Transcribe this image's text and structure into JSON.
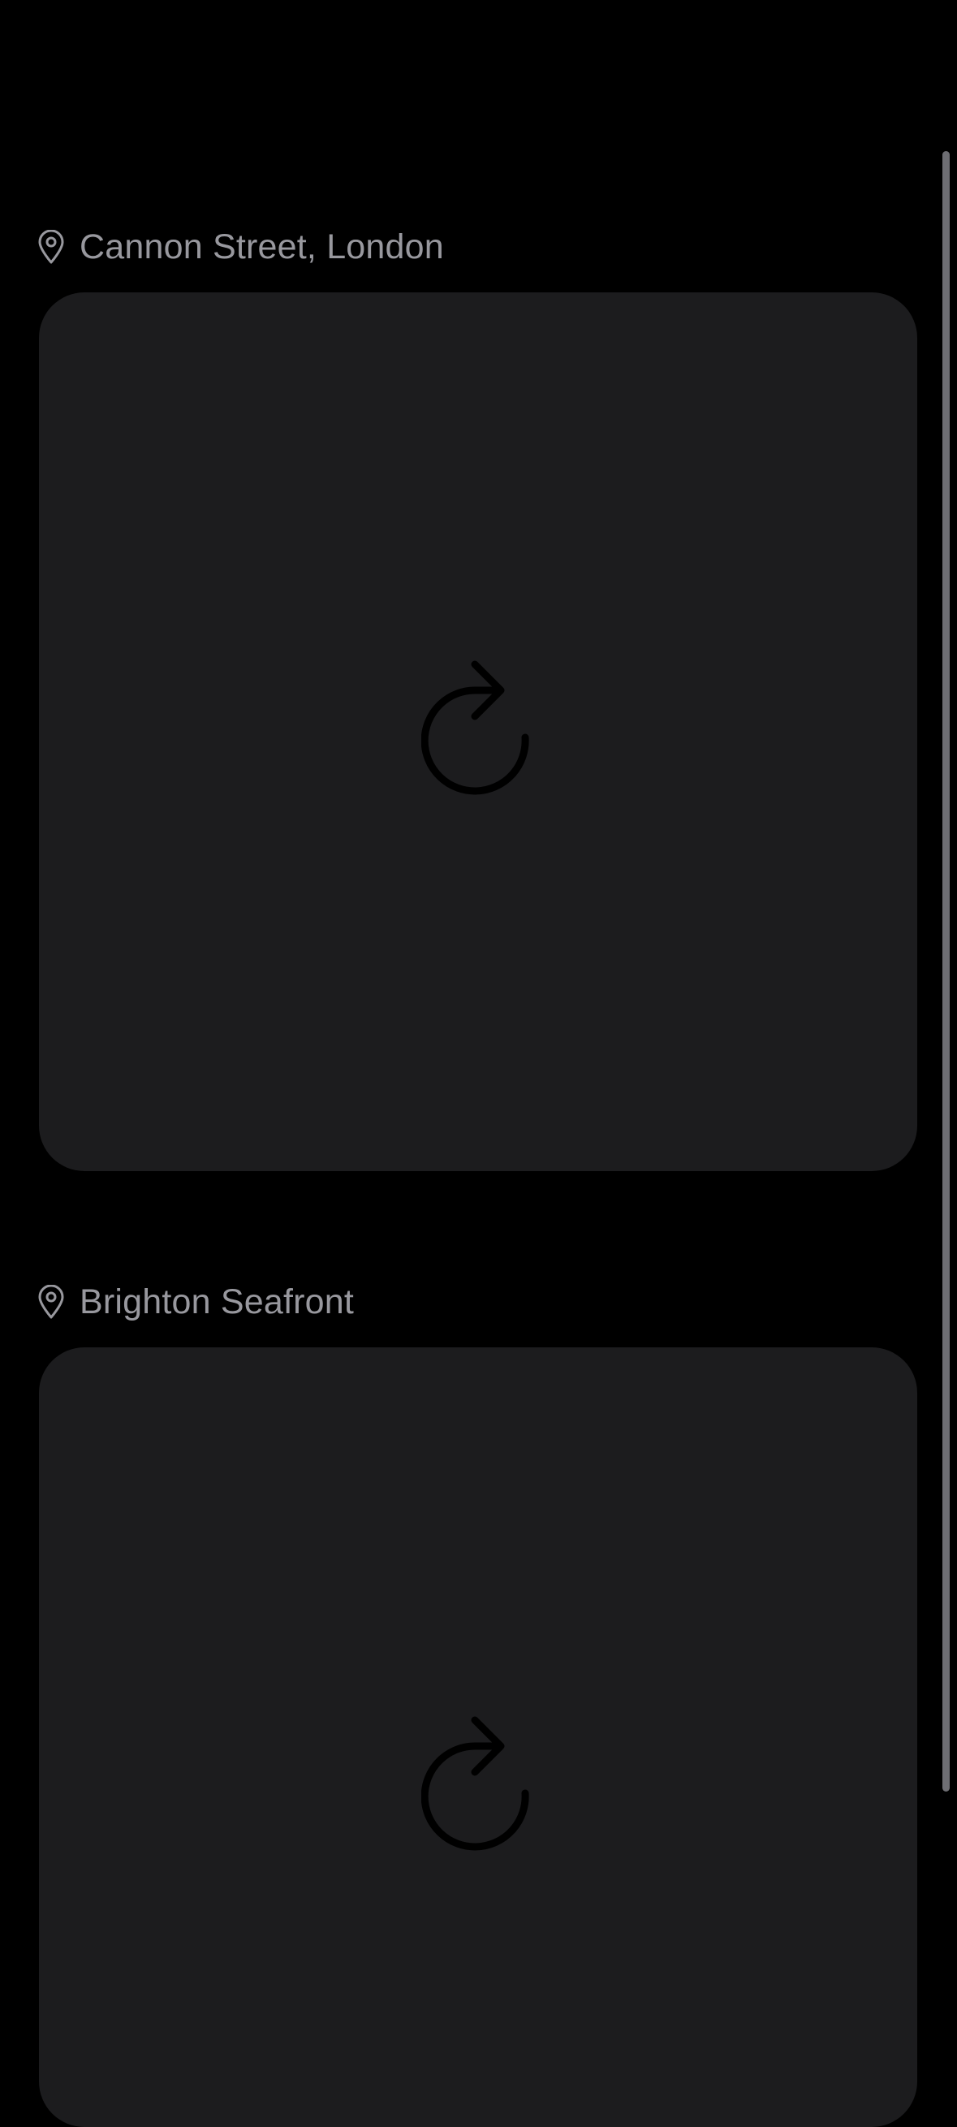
{
  "colors": {
    "background": "#000000",
    "card": "#1c1c1e",
    "label_text": "#98989e",
    "reload_icon": "#000000",
    "scrollbar": "#6e6e73"
  },
  "feed": {
    "items": [
      {
        "location": "Cannon Street, London",
        "pin_icon": "map-pin-icon",
        "content_state_icon": "reload-icon"
      },
      {
        "location": "Brighton Seafront",
        "pin_icon": "map-pin-icon",
        "content_state_icon": "reload-icon"
      }
    ]
  }
}
